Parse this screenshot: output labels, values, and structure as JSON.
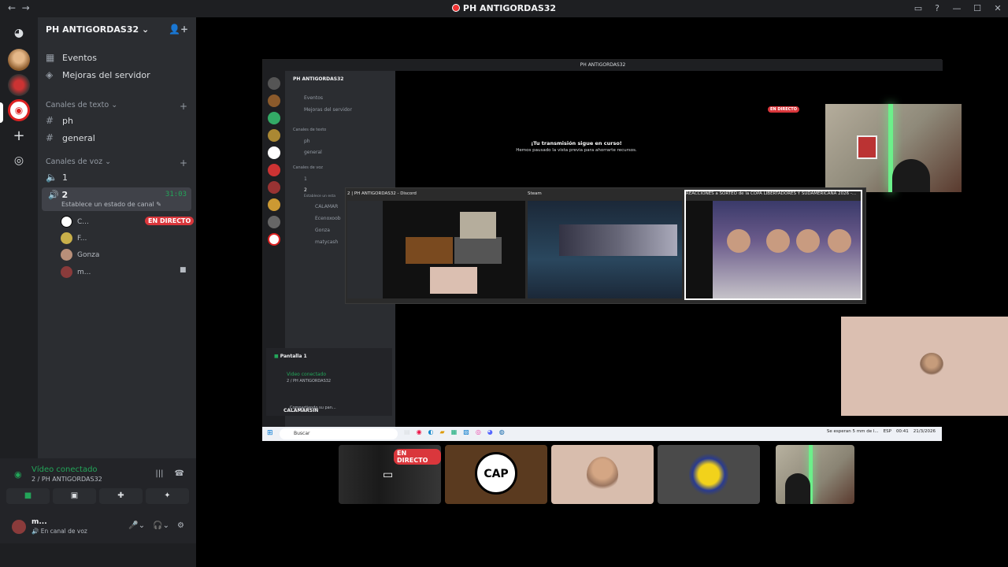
{
  "window": {
    "title": "PH ANTIGORDAS32"
  },
  "server": {
    "name": "PH ANTIGORDAS32"
  },
  "nav": {
    "events": "Eventos",
    "boosts": "Mejoras del servidor"
  },
  "text_category": "Canales de texto",
  "text_channels": [
    "ph",
    "general"
  ],
  "voice_category": "Canales de voz",
  "voice_channels": [
    {
      "name": "1"
    },
    {
      "name": "2",
      "time": "31:03",
      "status": "Establece un estado de canal"
    }
  ],
  "voice_users": [
    {
      "name": "C...",
      "live": "EN DIRECTO"
    },
    {
      "name": "F..."
    },
    {
      "name": "Gonza"
    },
    {
      "name": "m..."
    }
  ],
  "panel": {
    "connected": "Vídeo conectado",
    "location": "2 / PH ANTIGORDAS32",
    "user": "m...",
    "user_status": "En canal de voz"
  },
  "inner": {
    "title": "PH ANTIGORDAS32",
    "server": "PH ANTIGORDAS32",
    "events": "Eventos",
    "boosts": "Mejoras del servidor",
    "cat_text": "Canales de texto",
    "ch_ph": "ph",
    "ch_general": "general",
    "cat_voice": "Canales de voz",
    "ch_1": "1",
    "ch_2": "2",
    "ch_status": "Establece un esta",
    "users": [
      "CALAMAR",
      "Ecenoxoob",
      "Gonza",
      "matycash"
    ],
    "live": "EN DIRECTO",
    "stream_title": "¡Tu transmisión sigue en curso!",
    "stream_sub": "Hemos pausado la vista previa para ahorrarte recursos.",
    "screen_label": "Pantalla 1",
    "connected": "Video conectado",
    "location": "2 / PH ANTIGORDAS32",
    "me_name": "CALAMARSIN",
    "me_status": "Compartiendo su pan..."
  },
  "alttab": [
    {
      "label": "2 | PH ANTIGORDAS32 - Discord"
    },
    {
      "label": "Steam"
    },
    {
      "label": "REACCIONES a SORTEO de la COPA LIBERTADORES Y SUDAMERICANA 2026 -..."
    }
  ],
  "taskbar": {
    "search": "Buscar",
    "tray_note": "Se esperan 5 mm de l...",
    "lang": "ESP",
    "time": "00:41",
    "date": "21/3/2026"
  },
  "tiles": [
    {
      "kind": "screen",
      "live": "EN DIRECTO"
    },
    {
      "kind": "avatar",
      "badge": "CAP"
    },
    {
      "kind": "camera"
    },
    {
      "kind": "avatar"
    },
    {
      "kind": "camera"
    }
  ]
}
